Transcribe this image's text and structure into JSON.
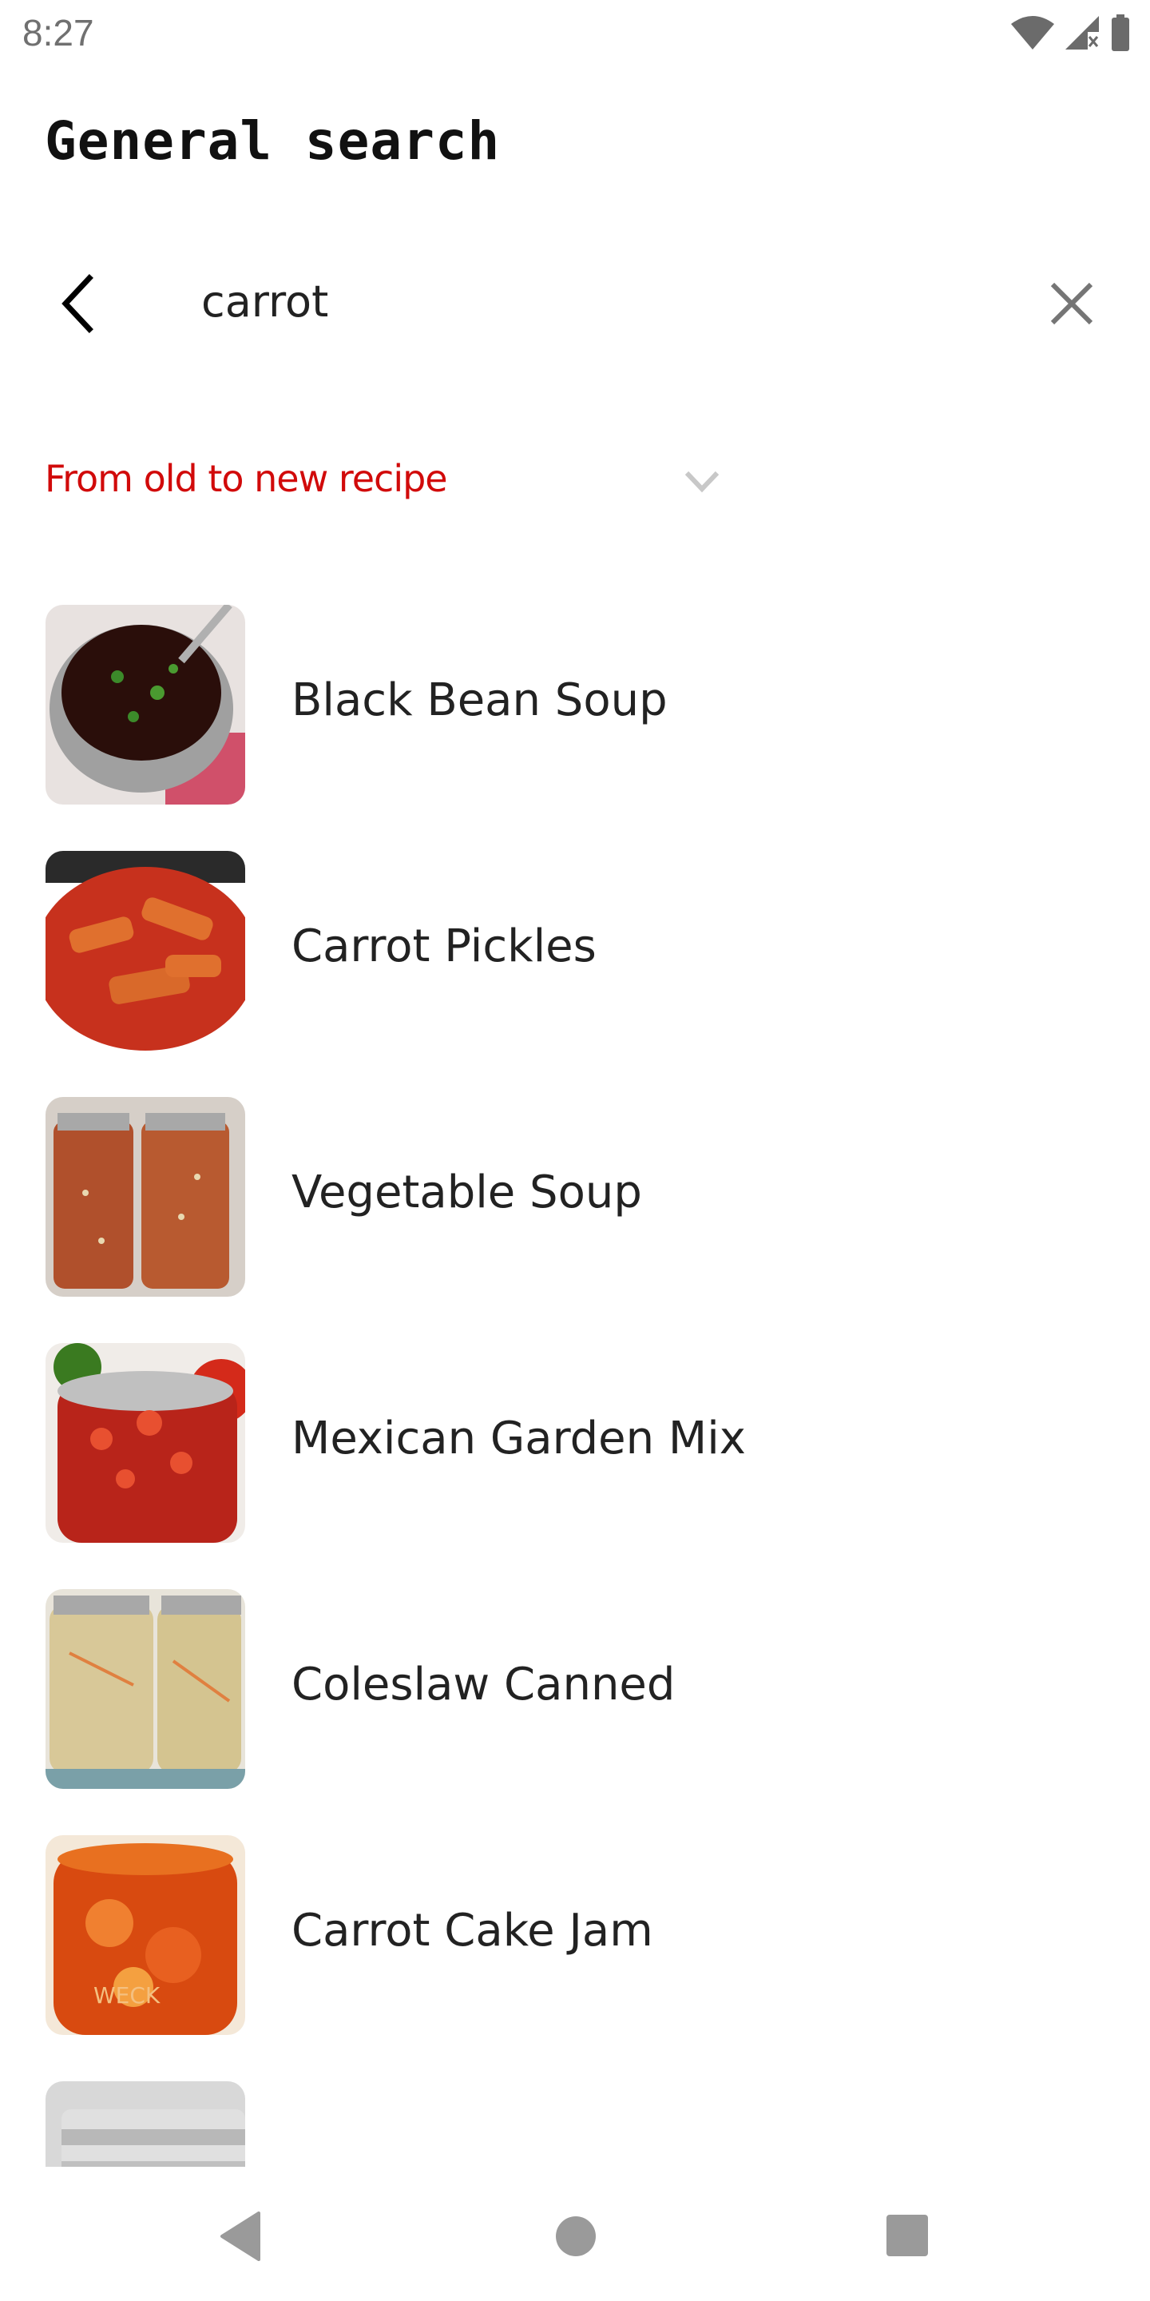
{
  "status_bar": {
    "time": "8:27",
    "icons": [
      "wifi-icon",
      "signal-icon",
      "battery-icon"
    ]
  },
  "header": {
    "title": "General search"
  },
  "search": {
    "value": "carrot",
    "placeholder": "",
    "back_icon": "chevron-left-icon",
    "clear_icon": "close-icon"
  },
  "sort": {
    "selected": "From old to new recipe",
    "icon": "chevron-down-icon",
    "color": "#d10a0a"
  },
  "results": [
    {
      "title": "Black Bean Soup"
    },
    {
      "title": "Carrot Pickles"
    },
    {
      "title": "Vegetable Soup"
    },
    {
      "title": "Mexican Garden Mix"
    },
    {
      "title": "Coleslaw Canned"
    },
    {
      "title": "Carrot Cake Jam"
    },
    {
      "title": ""
    }
  ],
  "nav_bar": {
    "buttons": [
      "back-icon",
      "home-icon",
      "recents-icon"
    ]
  }
}
